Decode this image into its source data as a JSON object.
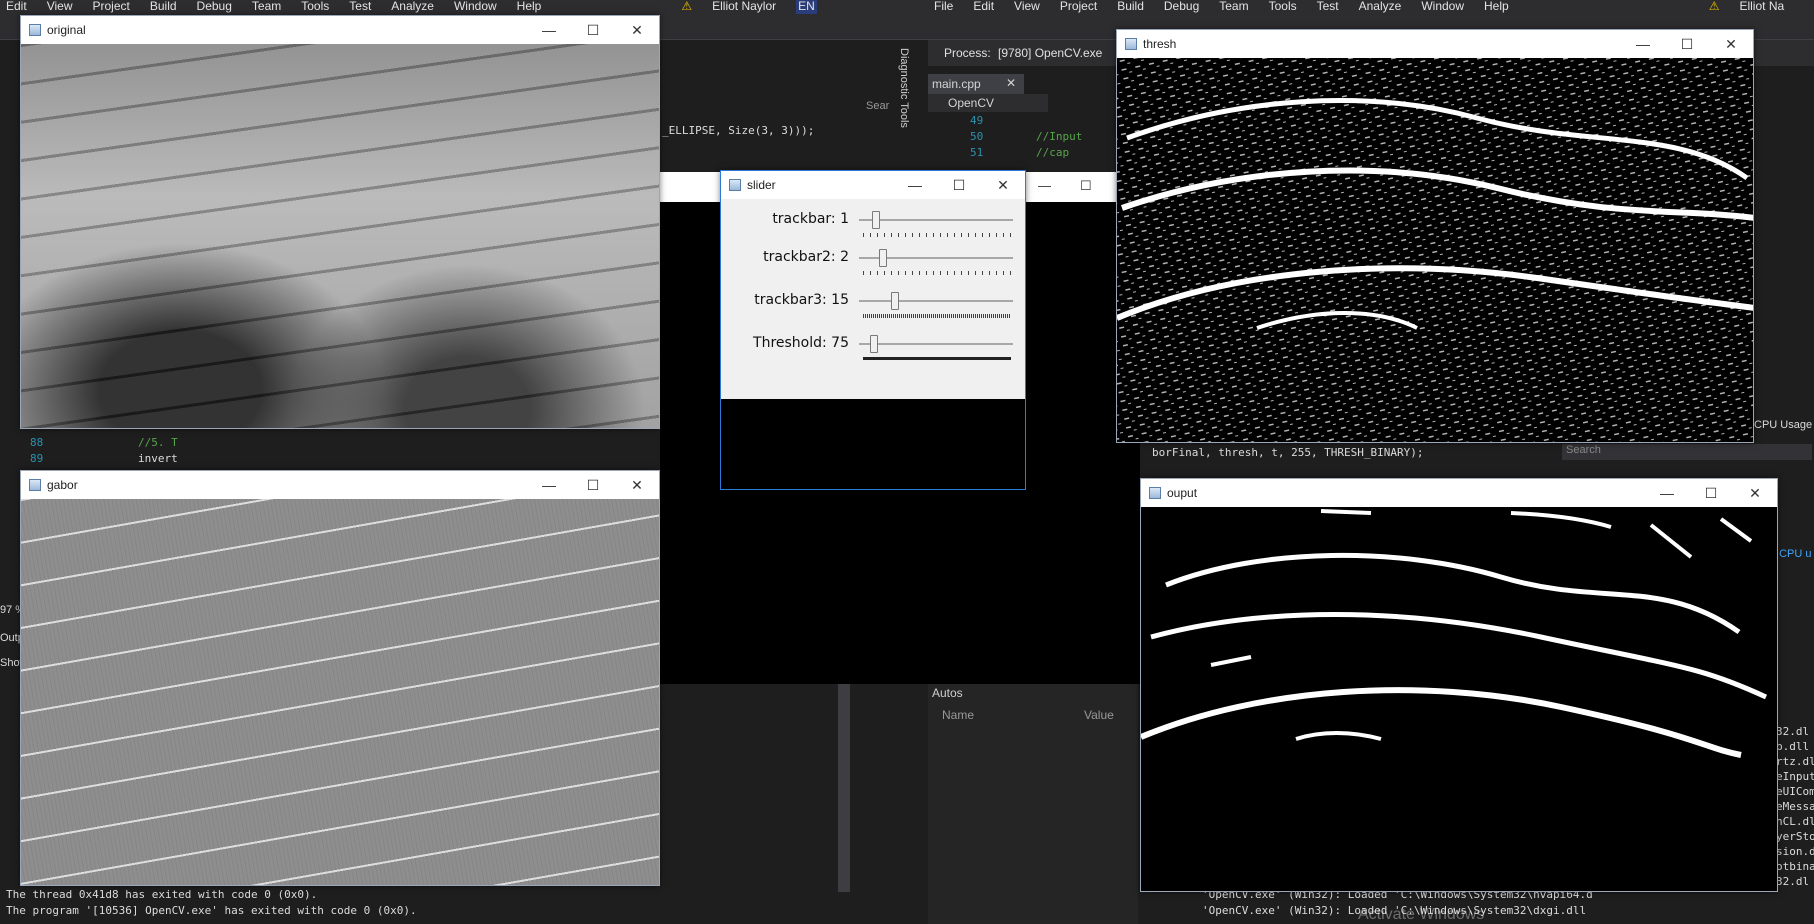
{
  "left_vs": {
    "menu": [
      "Edit",
      "View",
      "Project",
      "Build",
      "Debug",
      "Team",
      "Tools",
      "Test",
      "Analyze",
      "Window",
      "Help"
    ],
    "user": "Elliot Naylor",
    "lang": "EN",
    "code_fragment": "_ELLIPSE, Size(3, 3)));",
    "gutter_lines": [
      {
        "num": "88",
        "code": "//5. T"
      },
      {
        "num": "89",
        "code": "invert"
      }
    ],
    "zoom_text": "97 %",
    "output_tabs": [
      "Outp",
      "Show"
    ],
    "output_lines": [
      "The thread 0x41d8 has exited with code 0 (0x0).",
      "The program '[10536] OpenCV.exe' has exited with code 0 (0x0)."
    ],
    "tool_tab": "Diagnostic Tools",
    "search_hint": "Sear"
  },
  "right_vs": {
    "menu": [
      "File",
      "Edit",
      "View",
      "Project",
      "Build",
      "Debug",
      "Team",
      "Tools",
      "Test",
      "Analyze",
      "Window",
      "Help"
    ],
    "user": "Elliot Na",
    "process_label": "Process:",
    "process_value": "[9780] OpenCV.exe",
    "file_tab": "main.cpp",
    "project": "OpenCV",
    "code_lines": [
      {
        "num": "49",
        "code": ""
      },
      {
        "num": "50",
        "code": "//Input"
      },
      {
        "num": "51",
        "code": "//cap"
      }
    ],
    "threshold_code": "borFinal, thresh, t, 255, THRESH_BINARY);",
    "autos_title": "Autos",
    "autos_cols": [
      "Name",
      "Value"
    ],
    "search_placeholder": "Search",
    "cpu_usage": "CPU Usage",
    "cpu_link": "f CPU u",
    "dll_fragments": [
      "32.dl",
      "b.dll",
      "rtz.dl",
      "eInput",
      "eUICom",
      "eMessa",
      "nCL.dl",
      "yerSto",
      "sion.d",
      "otbina",
      "32.dl"
    ],
    "output_lines": [
      "'OpenCV.exe' (Win32): Loaded 'C:\\Windows\\System32\\nvapi64.d",
      "'OpenCV.exe' (Win32): Loaded 'C:\\Windows\\System32\\dxgi.dll"
    ],
    "watermark": "Activate Windows"
  },
  "windows": {
    "original": {
      "title": "original"
    },
    "gabor": {
      "title": "gabor"
    },
    "thresh": {
      "title": "thresh"
    },
    "ouput": {
      "title": "ouput"
    },
    "slider": {
      "title": "slider"
    }
  },
  "trackbars": [
    {
      "label": "trackbar: 1",
      "value": 1,
      "max": 20
    },
    {
      "label": "trackbar2: 2",
      "value": 2,
      "max": 20
    },
    {
      "label": "trackbar3: 15",
      "value": 15,
      "max": 80
    },
    {
      "label": "Threshold: 75",
      "value": 75,
      "max": 2000
    }
  ],
  "control_glyphs": {
    "minimize": "—",
    "maximize": "☐",
    "close": "✕"
  }
}
